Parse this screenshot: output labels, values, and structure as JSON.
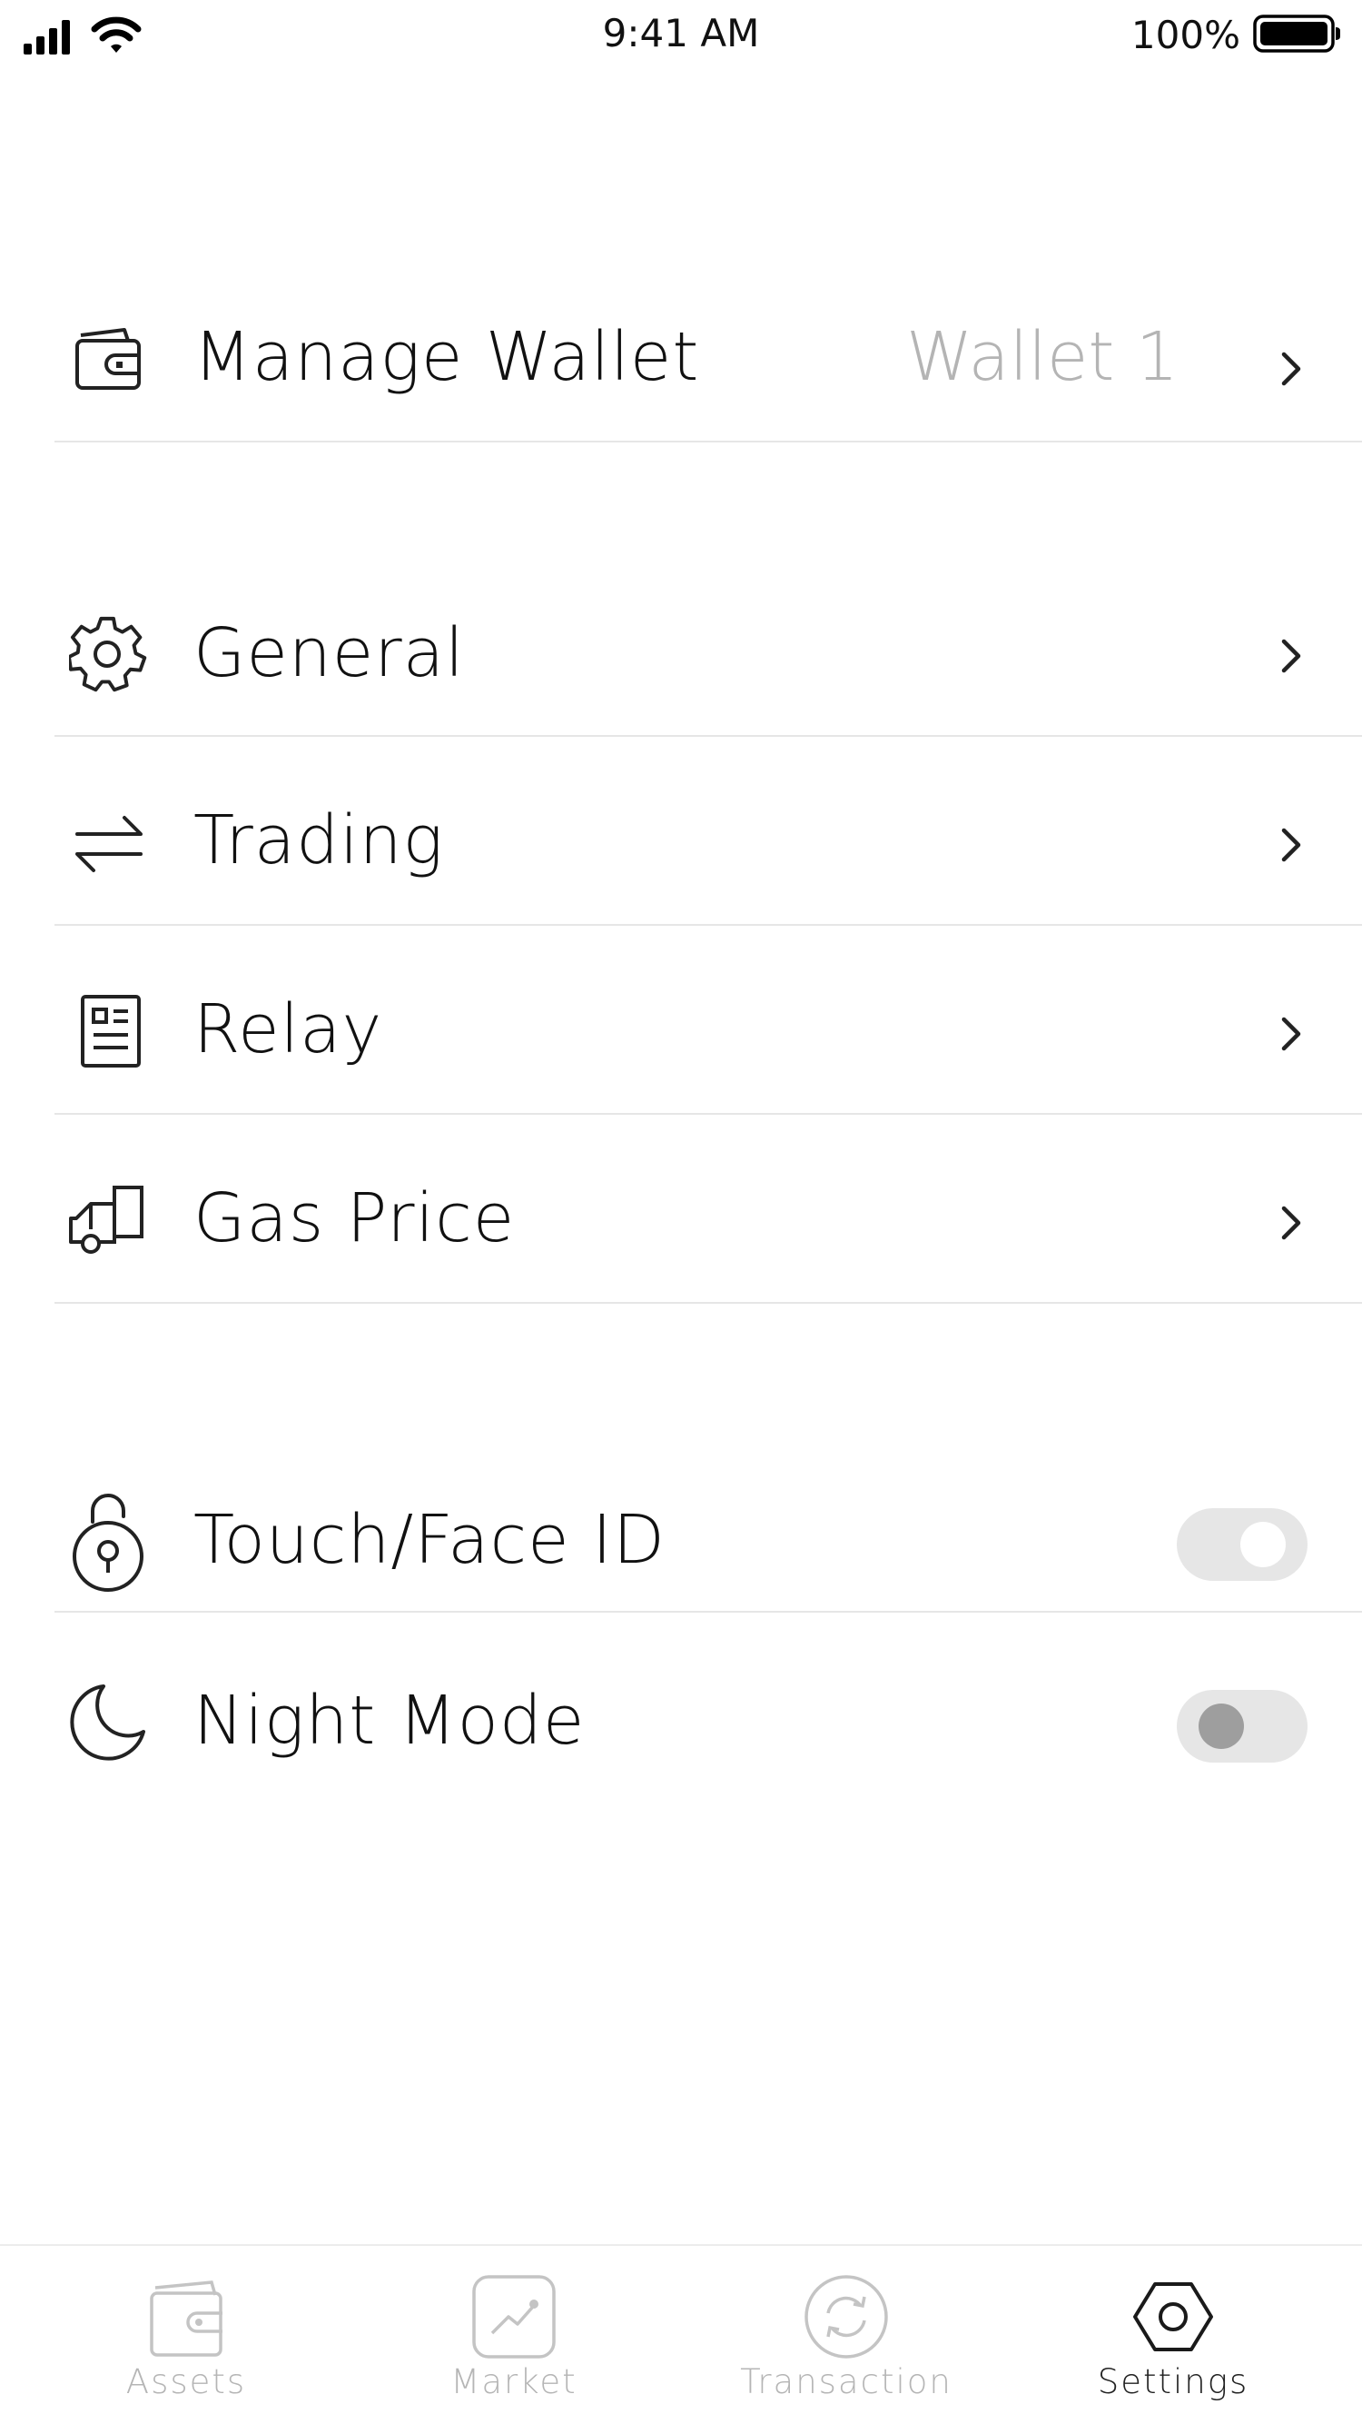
{
  "status_bar": {
    "time": "9:41 AM",
    "battery_percent": "100%",
    "icons": [
      "signal-icon",
      "wifi-icon",
      "battery-icon"
    ]
  },
  "settings": {
    "manage_wallet": {
      "label": "Manage Wallet",
      "value": "Wallet 1",
      "icon": "wallet-icon"
    },
    "general": {
      "label": "General",
      "icon": "gear-icon"
    },
    "trading": {
      "label": "Trading",
      "icon": "swap-arrows-icon"
    },
    "relay": {
      "label": "Relay",
      "icon": "document-icon"
    },
    "gas_price": {
      "label": "Gas Price",
      "icon": "gas-pump-icon"
    },
    "touch_face_id": {
      "label": "Touch/Face ID",
      "icon": "unlock-icon",
      "enabled": true
    },
    "night_mode": {
      "label": "Night Mode",
      "icon": "moon-icon",
      "enabled": false
    }
  },
  "tab_bar": {
    "tabs": [
      {
        "label": "Assets",
        "icon": "wallet-tab-icon",
        "active": false
      },
      {
        "label": "Market",
        "icon": "chart-tab-icon",
        "active": false
      },
      {
        "label": "Transaction",
        "icon": "refresh-tab-icon",
        "active": false
      },
      {
        "label": "Settings",
        "icon": "hexagon-settings-icon",
        "active": true
      }
    ]
  },
  "colors": {
    "text_primary": "#111111",
    "text_secondary": "#b4b4b4",
    "divider": "#e6e6e6",
    "toggle_track": "#e6e6e6",
    "toggle_knob_off": "#9e9e9e",
    "tab_inactive": "#b5b5b5",
    "tab_active": "#222222"
  }
}
